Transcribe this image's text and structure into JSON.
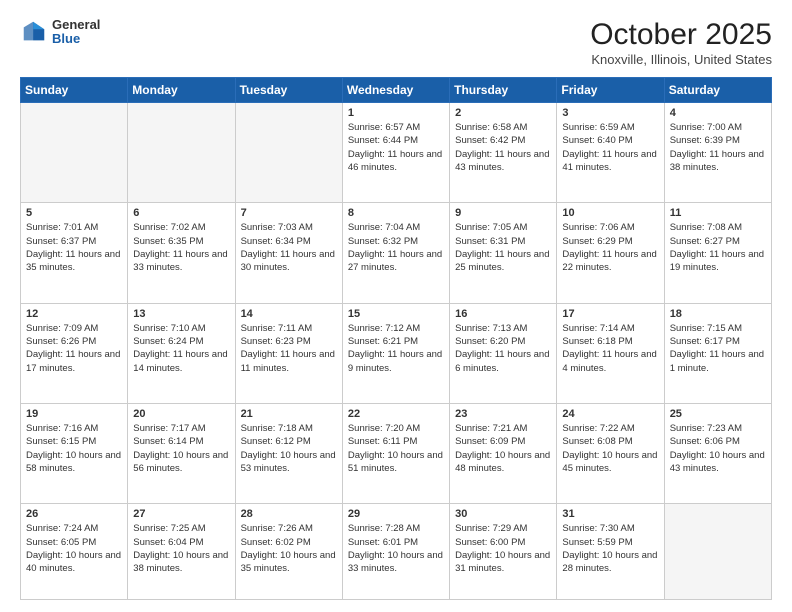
{
  "header": {
    "logo": {
      "general": "General",
      "blue": "Blue"
    },
    "title": "October 2025",
    "subtitle": "Knoxville, Illinois, United States"
  },
  "days_of_week": [
    "Sunday",
    "Monday",
    "Tuesday",
    "Wednesday",
    "Thursday",
    "Friday",
    "Saturday"
  ],
  "weeks": [
    [
      {
        "day": "",
        "empty": true
      },
      {
        "day": "",
        "empty": true
      },
      {
        "day": "",
        "empty": true
      },
      {
        "day": "1",
        "sunrise": "6:57 AM",
        "sunset": "6:44 PM",
        "daylight": "11 hours and 46 minutes."
      },
      {
        "day": "2",
        "sunrise": "6:58 AM",
        "sunset": "6:42 PM",
        "daylight": "11 hours and 43 minutes."
      },
      {
        "day": "3",
        "sunrise": "6:59 AM",
        "sunset": "6:40 PM",
        "daylight": "11 hours and 41 minutes."
      },
      {
        "day": "4",
        "sunrise": "7:00 AM",
        "sunset": "6:39 PM",
        "daylight": "11 hours and 38 minutes."
      }
    ],
    [
      {
        "day": "5",
        "sunrise": "7:01 AM",
        "sunset": "6:37 PM",
        "daylight": "11 hours and 35 minutes."
      },
      {
        "day": "6",
        "sunrise": "7:02 AM",
        "sunset": "6:35 PM",
        "daylight": "11 hours and 33 minutes."
      },
      {
        "day": "7",
        "sunrise": "7:03 AM",
        "sunset": "6:34 PM",
        "daylight": "11 hours and 30 minutes."
      },
      {
        "day": "8",
        "sunrise": "7:04 AM",
        "sunset": "6:32 PM",
        "daylight": "11 hours and 27 minutes."
      },
      {
        "day": "9",
        "sunrise": "7:05 AM",
        "sunset": "6:31 PM",
        "daylight": "11 hours and 25 minutes."
      },
      {
        "day": "10",
        "sunrise": "7:06 AM",
        "sunset": "6:29 PM",
        "daylight": "11 hours and 22 minutes."
      },
      {
        "day": "11",
        "sunrise": "7:08 AM",
        "sunset": "6:27 PM",
        "daylight": "11 hours and 19 minutes."
      }
    ],
    [
      {
        "day": "12",
        "sunrise": "7:09 AM",
        "sunset": "6:26 PM",
        "daylight": "11 hours and 17 minutes."
      },
      {
        "day": "13",
        "sunrise": "7:10 AM",
        "sunset": "6:24 PM",
        "daylight": "11 hours and 14 minutes."
      },
      {
        "day": "14",
        "sunrise": "7:11 AM",
        "sunset": "6:23 PM",
        "daylight": "11 hours and 11 minutes."
      },
      {
        "day": "15",
        "sunrise": "7:12 AM",
        "sunset": "6:21 PM",
        "daylight": "11 hours and 9 minutes."
      },
      {
        "day": "16",
        "sunrise": "7:13 AM",
        "sunset": "6:20 PM",
        "daylight": "11 hours and 6 minutes."
      },
      {
        "day": "17",
        "sunrise": "7:14 AM",
        "sunset": "6:18 PM",
        "daylight": "11 hours and 4 minutes."
      },
      {
        "day": "18",
        "sunrise": "7:15 AM",
        "sunset": "6:17 PM",
        "daylight": "11 hours and 1 minute."
      }
    ],
    [
      {
        "day": "19",
        "sunrise": "7:16 AM",
        "sunset": "6:15 PM",
        "daylight": "10 hours and 58 minutes."
      },
      {
        "day": "20",
        "sunrise": "7:17 AM",
        "sunset": "6:14 PM",
        "daylight": "10 hours and 56 minutes."
      },
      {
        "day": "21",
        "sunrise": "7:18 AM",
        "sunset": "6:12 PM",
        "daylight": "10 hours and 53 minutes."
      },
      {
        "day": "22",
        "sunrise": "7:20 AM",
        "sunset": "6:11 PM",
        "daylight": "10 hours and 51 minutes."
      },
      {
        "day": "23",
        "sunrise": "7:21 AM",
        "sunset": "6:09 PM",
        "daylight": "10 hours and 48 minutes."
      },
      {
        "day": "24",
        "sunrise": "7:22 AM",
        "sunset": "6:08 PM",
        "daylight": "10 hours and 45 minutes."
      },
      {
        "day": "25",
        "sunrise": "7:23 AM",
        "sunset": "6:06 PM",
        "daylight": "10 hours and 43 minutes."
      }
    ],
    [
      {
        "day": "26",
        "sunrise": "7:24 AM",
        "sunset": "6:05 PM",
        "daylight": "10 hours and 40 minutes."
      },
      {
        "day": "27",
        "sunrise": "7:25 AM",
        "sunset": "6:04 PM",
        "daylight": "10 hours and 38 minutes."
      },
      {
        "day": "28",
        "sunrise": "7:26 AM",
        "sunset": "6:02 PM",
        "daylight": "10 hours and 35 minutes."
      },
      {
        "day": "29",
        "sunrise": "7:28 AM",
        "sunset": "6:01 PM",
        "daylight": "10 hours and 33 minutes."
      },
      {
        "day": "30",
        "sunrise": "7:29 AM",
        "sunset": "6:00 PM",
        "daylight": "10 hours and 31 minutes."
      },
      {
        "day": "31",
        "sunrise": "7:30 AM",
        "sunset": "5:59 PM",
        "daylight": "10 hours and 28 minutes."
      },
      {
        "day": "",
        "empty": true
      }
    ]
  ],
  "labels": {
    "sunrise": "Sunrise:",
    "sunset": "Sunset:",
    "daylight": "Daylight:"
  }
}
